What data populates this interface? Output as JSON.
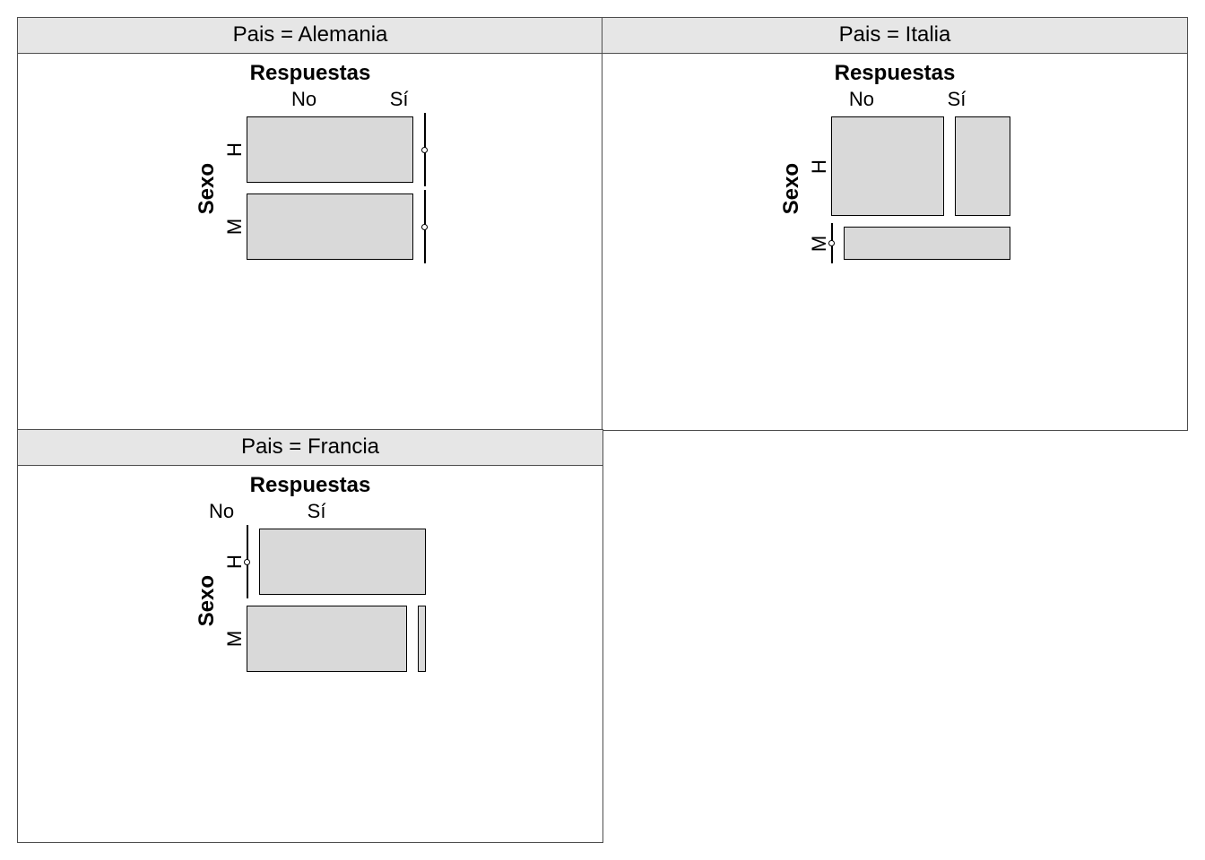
{
  "chart_data": [
    {
      "type": "mosaic",
      "facet": "Pais = Alemania",
      "title": "Respuestas",
      "xlabel": "Respuestas",
      "ylabel": "Sexo",
      "col_categories": [
        "No",
        "Sí"
      ],
      "row_categories": [
        "H",
        "M"
      ],
      "cells": {
        "H": {
          "No": 0.99,
          "Sí": 0.01
        },
        "M": {
          "No": 0.99,
          "Sí": 0.01
        }
      },
      "row_heights": {
        "H": 0.5,
        "M": 0.5
      }
    },
    {
      "type": "mosaic",
      "facet": "Pais = Italia",
      "title": "Respuestas",
      "xlabel": "Respuestas",
      "ylabel": "Sexo",
      "col_categories": [
        "No",
        "Sí"
      ],
      "row_categories": [
        "H",
        "M"
      ],
      "cells": {
        "H": {
          "No": 0.67,
          "Sí": 0.33
        },
        "M": {
          "No": 0.01,
          "Sí": 0.99
        }
      },
      "row_heights": {
        "H": 0.75,
        "M": 0.25
      }
    },
    {
      "type": "mosaic",
      "facet": "Pais = Francia",
      "title": "Respuestas",
      "xlabel": "Respuestas",
      "ylabel": "Sexo",
      "col_categories": [
        "No",
        "Sí"
      ],
      "row_categories": [
        "H",
        "M"
      ],
      "cells": {
        "H": {
          "No": 0.01,
          "Sí": 0.99
        },
        "M": {
          "No": 0.95,
          "Sí": 0.05
        }
      },
      "row_heights": {
        "H": 0.5,
        "M": 0.5
      }
    }
  ],
  "labels": {
    "respuestas": "Respuestas",
    "sexo": "Sexo",
    "no": "No",
    "si": "Sí",
    "h": "H",
    "m": "M",
    "alemania": "Pais = Alemania",
    "italia": "Pais = Italia",
    "francia": "Pais = Francia"
  }
}
